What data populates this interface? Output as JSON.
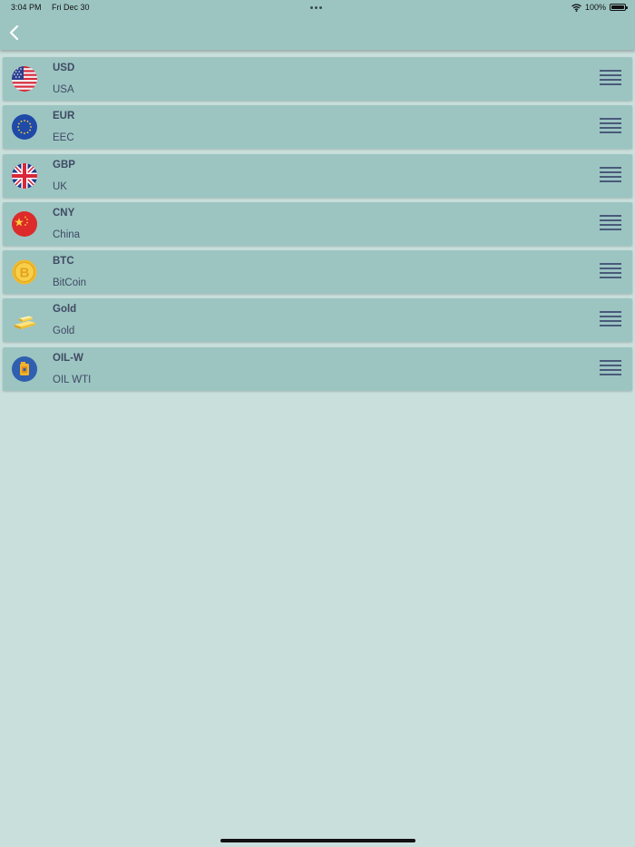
{
  "status_bar": {
    "time": "3:04 PM",
    "date": "Fri Dec 30",
    "battery": "100%",
    "battery_level": 1.0
  },
  "nav": {
    "back_icon": "chevron-left-icon"
  },
  "currencies": [
    {
      "code": "USD",
      "name": "USA",
      "icon": "us-flag-icon"
    },
    {
      "code": "EUR",
      "name": "EEC",
      "icon": "eu-flag-icon"
    },
    {
      "code": "GBP",
      "name": "UK",
      "icon": "uk-flag-icon"
    },
    {
      "code": "CNY",
      "name": "China",
      "icon": "china-flag-icon"
    },
    {
      "code": "BTC",
      "name": "BitCoin",
      "icon": "bitcoin-icon"
    },
    {
      "code": "Gold",
      "name": "Gold",
      "icon": "gold-bar-icon"
    },
    {
      "code": "OIL-W",
      "name": "OIL WTI",
      "icon": "oil-can-icon"
    }
  ],
  "colors": {
    "background": "#c9dfdc",
    "header": "#9cc5c2",
    "row": "#9cc5c2",
    "text": "#3f4a63",
    "handle": "#4a5a7a"
  }
}
